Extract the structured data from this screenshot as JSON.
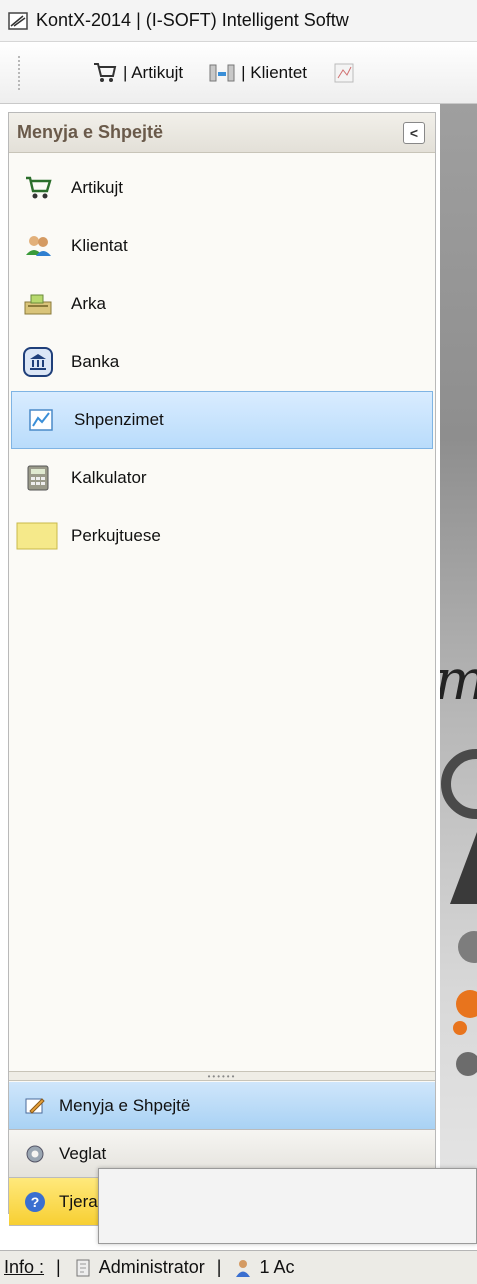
{
  "window": {
    "title": "KontX-2014 | (I-SOFT) Intelligent Softw"
  },
  "toolbar": {
    "items": [
      {
        "label": "| Artikujt",
        "icon": "cart-icon"
      },
      {
        "label": "| Klientet",
        "icon": "clients-icon"
      }
    ]
  },
  "sidebar": {
    "title": "Menyja e Shpejtë",
    "collapse_label": "<",
    "items": [
      {
        "label": "Artikujt",
        "icon": "cart-icon"
      },
      {
        "label": "Klientat",
        "icon": "people-icon"
      },
      {
        "label": "Arka",
        "icon": "cash-register-icon"
      },
      {
        "label": "Banka",
        "icon": "bank-icon"
      },
      {
        "label": "Shpenzimet",
        "icon": "expenses-icon",
        "active": true
      },
      {
        "label": "Kalkulator",
        "icon": "calculator-icon"
      },
      {
        "label": "Perkujtuese",
        "icon": "sticky-note-icon"
      }
    ],
    "nav_buttons": [
      {
        "label": "Menyja e Shpejtë",
        "icon": "quick-menu-icon"
      },
      {
        "label": "Veglat",
        "icon": "tools-gear-icon"
      },
      {
        "label": "Tjera",
        "icon": "help-icon"
      }
    ]
  },
  "statusbar": {
    "info_label": "Info :",
    "separator": "|",
    "user": "Administrator",
    "count": "1 Ac"
  },
  "colors": {
    "active_item": "#b9dcfb",
    "nav_menyja": "#a9d2f4",
    "nav_tjera": "#f7cf32",
    "sidebar_title": "#6a5a4a"
  }
}
